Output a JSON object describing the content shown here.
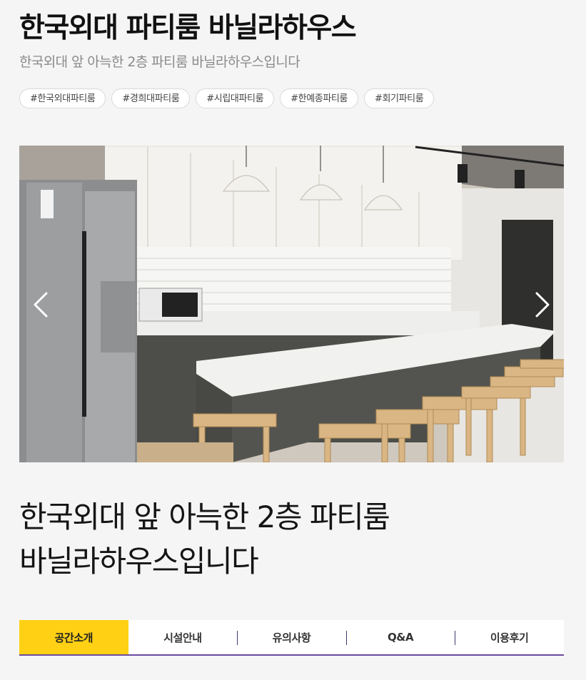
{
  "header": {
    "title": "한국외대 파티룸 바닐라하우스",
    "subtitle": "한국외대 앞 아늑한 2층 파티룸 바닐라하우스입니다"
  },
  "tags": [
    "#한국외대파티룸",
    "#경희대파티룸",
    "#시립대파티룸",
    "#한예종파티룸",
    "#회기파티룸"
  ],
  "gallery": {
    "prev_icon": "chevron-left-icon",
    "next_icon": "chevron-right-icon"
  },
  "description": {
    "line1": "한국외대 앞 아늑한 2층 파티룸",
    "line2": "바닐라하우스입니다"
  },
  "tabs": [
    {
      "label": "공간소개",
      "active": true
    },
    {
      "label": "시설안내",
      "active": false
    },
    {
      "label": "유의사항",
      "active": false
    },
    {
      "label": "Q&A",
      "active": false
    },
    {
      "label": "이용후기",
      "active": false
    }
  ],
  "colors": {
    "accent": "#ffd014",
    "tab_underline": "#6a4ba0",
    "background": "#f5f5f5"
  }
}
